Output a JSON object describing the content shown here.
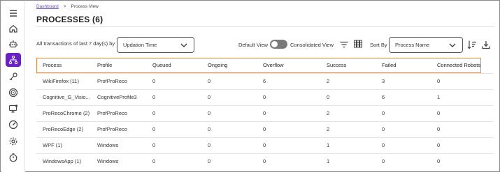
{
  "breadcrumb": {
    "home": "Dashboard",
    "separator": ">",
    "current": "Process View"
  },
  "page_title": "PROCESSES (6)",
  "sidebar": {
    "items": [
      {
        "icon": "menu-icon"
      },
      {
        "icon": "home-icon"
      },
      {
        "icon": "robot-icon"
      },
      {
        "icon": "process-tree-icon",
        "active": true
      },
      {
        "icon": "key-icon"
      },
      {
        "icon": "target-icon"
      },
      {
        "icon": "monitor-icon"
      },
      {
        "icon": "speed-gauge-icon"
      },
      {
        "icon": "settings-icon"
      },
      {
        "icon": "timer-icon"
      }
    ]
  },
  "filters": {
    "range_label": "All transactions of last 7 day(s) by",
    "range_select": "Updation Time",
    "default_view": "Default View",
    "consolidated_view": "Consolidated View",
    "sort_by_label": "Sort By",
    "sort_select": "Process Name"
  },
  "table": {
    "columns": [
      "Process",
      "Profile",
      "Queued",
      "Ongoing",
      "Overflow",
      "Success",
      "Failed",
      "Connected Robots"
    ],
    "rows": [
      [
        "WikiFirefox (11)",
        "ProfProReco",
        "0",
        "0",
        "6",
        "2",
        "3",
        "0"
      ],
      [
        "Cognitive_G_Visio...",
        "CognitiveProfile3",
        "0",
        "0",
        "0",
        "0",
        "6",
        "1"
      ],
      [
        "ProRecoChrome (2)",
        "ProfProReco",
        "0",
        "0",
        "0",
        "2",
        "0",
        "0"
      ],
      [
        "ProRecoEdge (2)",
        "ProfProReco",
        "0",
        "0",
        "0",
        "2",
        "0",
        "0"
      ],
      [
        "WPF (1)",
        "Windows",
        "0",
        "0",
        "0",
        "1",
        "0",
        "0"
      ],
      [
        "WindowsApp (1)",
        "Windows",
        "0",
        "0",
        "0",
        "1",
        "0",
        "0"
      ]
    ]
  },
  "colors": {
    "accent": "#6b21c8",
    "highlight_border": "#f08a3c",
    "link": "#6b4fc8"
  }
}
